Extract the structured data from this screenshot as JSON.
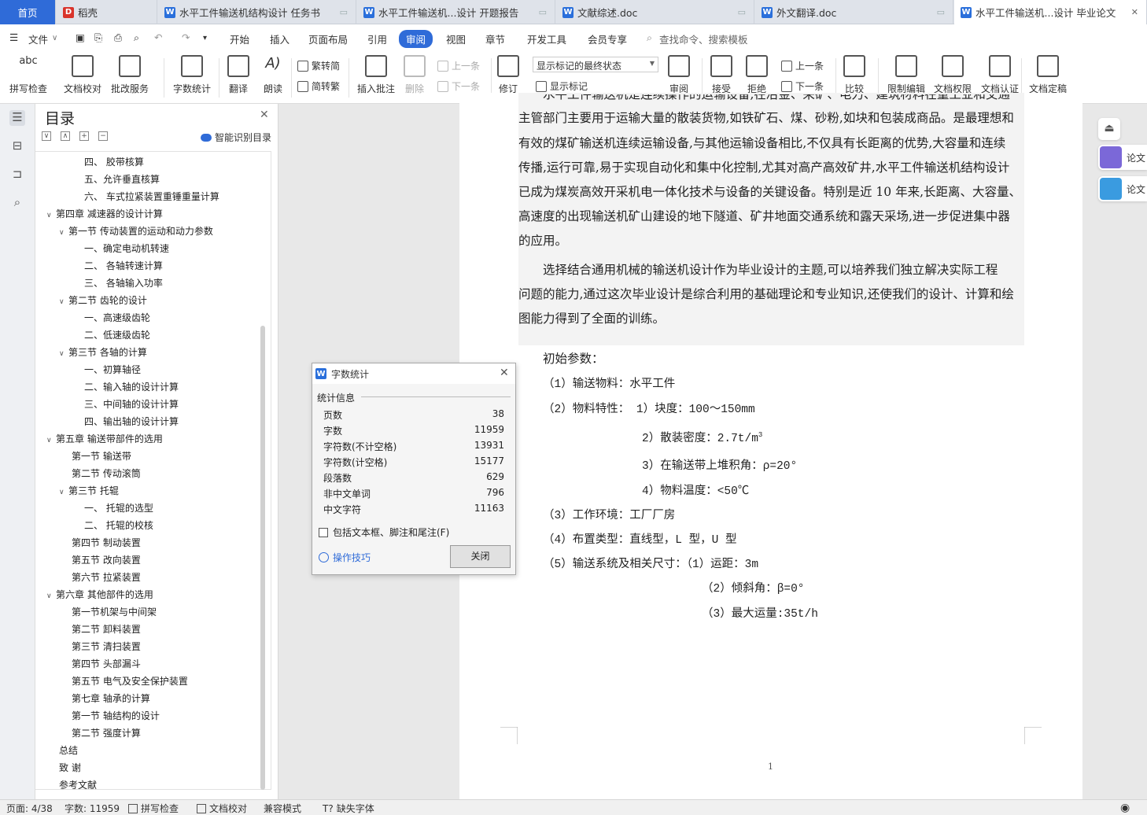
{
  "tabs": {
    "home": "首页",
    "t1": "稻壳",
    "t2": "水平工件输送机结构设计 任务书",
    "t3": "水平工件输送机...设计 开题报告",
    "t4": "文献综述.doc",
    "t5": "外文翻译.doc",
    "t6": "水平工件输送机...设计 毕业论文"
  },
  "menu": {
    "file": "文件",
    "items": [
      "开始",
      "插入",
      "页面布局",
      "引用",
      "审阅",
      "视图",
      "章节",
      "开发工具",
      "会员专享"
    ],
    "search": "查找命令、搜索模板"
  },
  "ribbon": {
    "spell": "拼写检查",
    "proof": "文档校对",
    "service": "批改服务",
    "wordcount": "字数统计",
    "translate": "翻译",
    "read": "朗读",
    "to_trad": "繁转简",
    "to_simp": "简转繁",
    "insert_comment": "插入批注",
    "delete": "删除",
    "prev": "上一条",
    "next": "下一条",
    "revise": "修订",
    "markup_state": "显示标记的最终状态",
    "show_markup": "显示标记",
    "review": "审阅",
    "accept": "接受",
    "reject": "拒绝",
    "prev2": "上一条",
    "next2": "下一条",
    "compare": "比较",
    "restrict": "限制编辑",
    "rights": "文档权限",
    "cert": "文档认证",
    "final": "文档定稿"
  },
  "toc": {
    "title": "目录",
    "smart": "智能识别目录",
    "items": [
      {
        "t": "四、 胶带核算",
        "l": 3
      },
      {
        "t": "五、允许垂直核算",
        "l": 3
      },
      {
        "t": "六、 车式拉紧装置重锤重量计算",
        "l": 3
      },
      {
        "t": "第四章  减速器的设计计算",
        "l": 1,
        "e": 1
      },
      {
        "t": "第一节  传动装置的运动和动力参数",
        "l": 2,
        "e": 1
      },
      {
        "t": "一、确定电动机转速",
        "l": 3
      },
      {
        "t": "二、  各轴转速计算",
        "l": 3
      },
      {
        "t": "三、  各轴输入功率",
        "l": 3
      },
      {
        "t": "第二节  齿轮的设计",
        "l": 2,
        "e": 1
      },
      {
        "t": "一、高速级齿轮",
        "l": 3
      },
      {
        "t": "二、低速级齿轮",
        "l": 3
      },
      {
        "t": "第三节  各轴的计算",
        "l": 2,
        "e": 1
      },
      {
        "t": "一、初算轴径",
        "l": 3
      },
      {
        "t": "二、输入轴的设计计算",
        "l": 3
      },
      {
        "t": "三、中间轴的设计计算",
        "l": 3
      },
      {
        "t": "四、输出轴的设计计算",
        "l": 3
      },
      {
        "t": "第五章  输送带部件的选用",
        "l": 1,
        "e": 1
      },
      {
        "t": "第一节     输送带",
        "l": 2
      },
      {
        "t": "第二节     传动滚筒",
        "l": 2
      },
      {
        "t": "第三节     托辊",
        "l": 2,
        "e": 1
      },
      {
        "t": "一、   托辊的选型",
        "l": 3
      },
      {
        "t": "二、   托辊的校核",
        "l": 3
      },
      {
        "t": "第四节     制动装置",
        "l": 2
      },
      {
        "t": "第五节  改向装置",
        "l": 2
      },
      {
        "t": "第六节  拉紧装置",
        "l": 2
      },
      {
        "t": "第六章    其他部件的选用",
        "l": 1,
        "e": 1
      },
      {
        "t": "第一节机架与中间架",
        "l": 2
      },
      {
        "t": "第二节  卸料装置",
        "l": 2
      },
      {
        "t": "第三节  清扫装置",
        "l": 2
      },
      {
        "t": "第四节  头部漏斗",
        "l": 2
      },
      {
        "t": "第五节  电气及安全保护装置",
        "l": 2
      },
      {
        "t": "第七章  轴承的计算",
        "l": 2
      },
      {
        "t": "第一节  轴结构的设计",
        "l": 2
      },
      {
        "t": "第二节  强度计算",
        "l": 2
      },
      {
        "t": "总结",
        "l": 1
      },
      {
        "t": "致 谢",
        "l": 1
      },
      {
        "t": "参考文献",
        "l": 1
      }
    ]
  },
  "doc": {
    "lines": [
      "水平工件输送机是连续操作的运输设备,在冶金、采矿、电力、建筑材料在重工业和交通",
      "主管部门主要用于运输大量的散装货物,如铁矿石、煤、砂粉,如块和包装成商品。是最理想和",
      "有效的煤矿输送机连续运输设备,与其他运输设备相比,不仅具有长距离的优势,大容量和连续",
      "传播,运行可靠,易于实现自动化和集中化控制,尤其对高产高效矿井,水平工件输送机结构设计",
      "已成为煤炭高效开采机电一体化技术与设备的关键设备。特别是近 10 年来,长距离、大容量、",
      "高速度的出现输送机矿山建设的地下隧道、矿井地面交通系统和露天采场,进一步促进集中器",
      "的应用。",
      "选择结合通用机械的输送机设计作为毕业设计的主题,可以培养我们独立解决实际工程",
      "问题的能力,通过这次毕业设计是综合利用的基础理论和专业知识,还使我们的设计、计算和绘",
      "图能力得到了全面的训练。"
    ],
    "p_init": "初始参数：",
    "p1": "（1）输送物料：水平工件",
    "p2": "（2）物料特性：  1）块度：100～150mm",
    "p2b": "2）散装密度：2.7t/m",
    "p2b_sup": "3",
    "p2c": "3）在输送带上堆积角：ρ=20°",
    "p2d": "4）物料温度：<50℃",
    "p3": "（3）工作环境：工厂厂房",
    "p4": "（4）布置类型：直线型，L 型，U 型",
    "p5": "（5）输送系统及相关尺寸：（1）运距：3m",
    "p5b": "（2）倾斜角：β=0°",
    "p5c": "（3）最大运量:35t/h",
    "page_no": "1"
  },
  "right": {
    "b1": "论文",
    "b2": "论文"
  },
  "dialog": {
    "title": "字数统计",
    "section": "统计信息",
    "rows": [
      {
        "k": "页数",
        "v": "38"
      },
      {
        "k": "字数",
        "v": "11959"
      },
      {
        "k": "字符数(不计空格)",
        "v": "13931"
      },
      {
        "k": "字符数(计空格)",
        "v": "15177"
      },
      {
        "k": "段落数",
        "v": "629"
      },
      {
        "k": "非中文单词",
        "v": "796"
      },
      {
        "k": "中文字符",
        "v": "11163"
      }
    ],
    "checkbox": "包括文本框、脚注和尾注(F)",
    "tip": "操作技巧",
    "close": "关闭"
  },
  "status": {
    "page": "页面: 4/38",
    "words": "字数: 11959",
    "spell": "拼写检查",
    "proof": "文档校对",
    "compat": "兼容模式",
    "font": "缺失字体"
  },
  "colors": {
    "accent": "#2f6bd8",
    "page": "#ffffff"
  }
}
